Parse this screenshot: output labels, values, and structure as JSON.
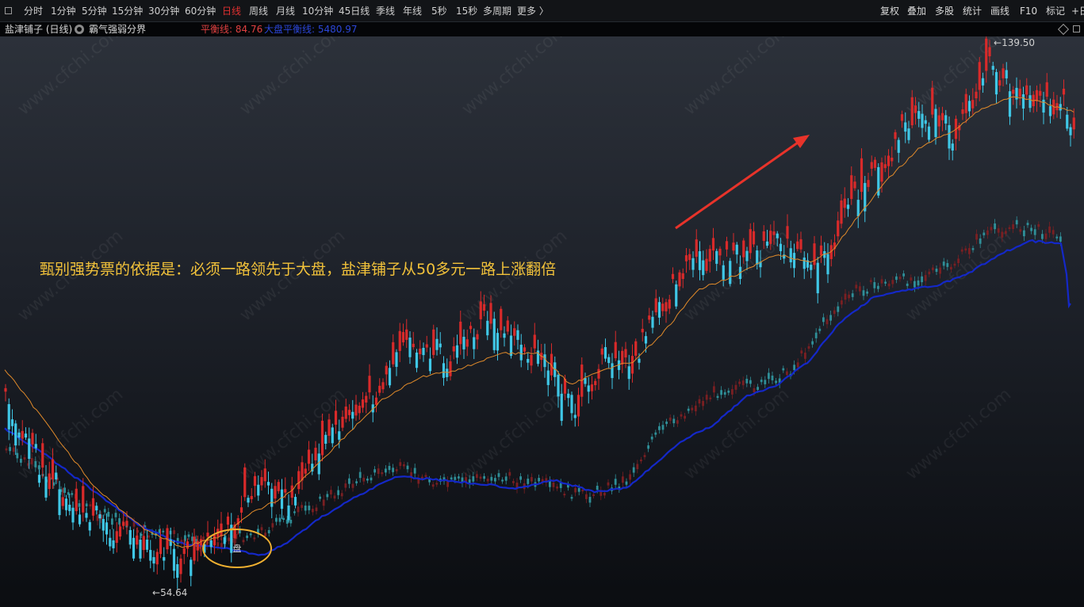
{
  "toolbar": {
    "tabs": [
      "分时",
      "1分钟",
      "5分钟",
      "15分钟",
      "30分钟",
      "60分钟",
      "日线",
      "周线",
      "月线",
      "10分钟",
      "45日线",
      "季线",
      "年线",
      "5秒",
      "15秒",
      "多周期",
      "更多 〉"
    ],
    "active_tab": "日线",
    "right_items": [
      "复权",
      "叠加",
      "多股",
      "统计",
      "画线",
      "F10",
      "标记",
      "+日"
    ]
  },
  "titlebar": {
    "stock": "盐津铺子 (日线)",
    "indicator": "霸气强弱分界",
    "balance_label": "平衡线: 84.76",
    "market_label": "大盘平衡线: 5480.97"
  },
  "annotation": {
    "text": "甄别强势票的依据是：必须一路领先于大盘，盐津铺子从50多元一路上涨翻倍",
    "circle_label": "盘"
  },
  "watermark_text": "www.cfchi.com",
  "colors": {
    "up": "#d82a2a",
    "down": "#3fc7e6",
    "ma": "#e08a2a",
    "market_line": "#1428c8",
    "arrow": "#e8332a",
    "annotation": "#f2c23a",
    "circle": "#f0b030"
  },
  "chart_data": {
    "type": "candlestick",
    "high_label": "139.50",
    "low_label": "54.64",
    "high": 139.5,
    "low": 54.64,
    "balance_value": 84.76,
    "market_balance_value": 5480.97
  }
}
